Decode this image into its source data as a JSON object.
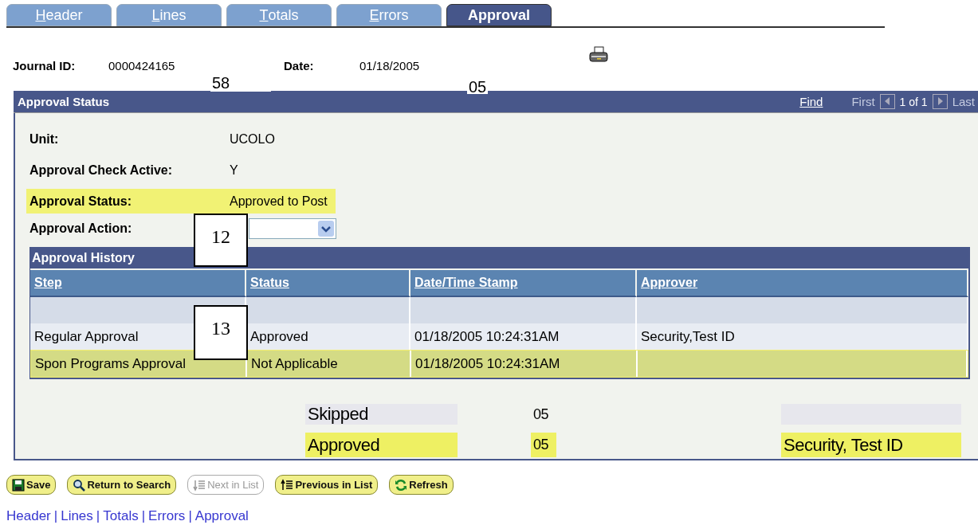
{
  "tabs": [
    {
      "label": "Header",
      "selected": false
    },
    {
      "label": "Lines",
      "selected": false
    },
    {
      "label": "Totals",
      "selected": false
    },
    {
      "label": "Errors",
      "selected": false
    },
    {
      "label": "Approval",
      "selected": true
    }
  ],
  "journal": {
    "label": "Journal ID:",
    "value": "0000424165"
  },
  "date": {
    "label": "Date:",
    "value": "01/18/2005"
  },
  "panel": {
    "title": "Approval Status",
    "find": "Find",
    "first": "First",
    "count": "1 of 1",
    "last": "Last"
  },
  "fields": [
    {
      "label": "Unit:",
      "value": "UCOLO",
      "highlighted": false
    },
    {
      "label": "Approval Check Active:",
      "value": "Y",
      "highlighted": false
    },
    {
      "label": "Approval Status:",
      "value": "Approved to Post",
      "highlighted": true
    }
  ],
  "action": {
    "label": "Approval Action:"
  },
  "history": {
    "title": "Approval History",
    "columns": [
      "Step",
      "Status",
      "Date/Time Stamp",
      "Approver"
    ],
    "rows": [
      {
        "cells": [],
        "kind": "blank"
      },
      {
        "cells": [
          "Regular Approval",
          "Approved",
          "01/18/2005 10:24:31AM",
          "Security,Test ID"
        ],
        "kind": "plain"
      },
      {
        "cells": [
          "Spon Programs Approval",
          "Not Applicable",
          "01/18/2005 10:24:31AM",
          ""
        ],
        "kind": "highlighted"
      }
    ]
  },
  "legend": [
    {
      "status": "Skipped",
      "code": "05",
      "highlighted": false
    },
    {
      "status": "Approved",
      "code": "05",
      "approver": "Security, Test ID",
      "highlighted": true
    }
  ],
  "callouts": [
    {
      "text": "58",
      "kind": "tag"
    },
    {
      "text": "05",
      "kind": "tag"
    },
    {
      "text": "12",
      "kind": "box"
    },
    {
      "text": "13",
      "kind": "box"
    }
  ],
  "buttons": [
    {
      "label": "Save",
      "kind": "save",
      "disabled": false
    },
    {
      "label": "Return to Search",
      "kind": "search",
      "disabled": false
    },
    {
      "label": "Next in List",
      "kind": "next",
      "disabled": true
    },
    {
      "label": "Previous in List",
      "kind": "previous",
      "disabled": false
    },
    {
      "label": "Refresh",
      "kind": "refresh",
      "disabled": false
    }
  ],
  "footer": {
    "separator": "|",
    "links": [
      "Header",
      "Lines",
      "Totals",
      "Errors",
      "Approval"
    ]
  }
}
